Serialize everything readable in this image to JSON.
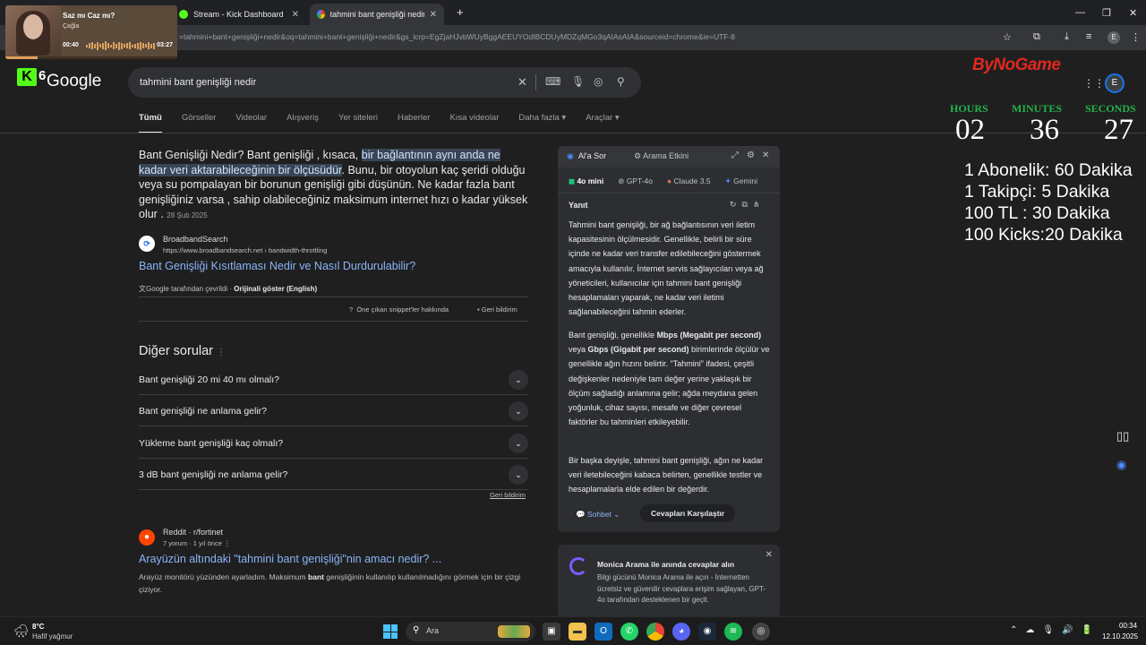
{
  "browser": {
    "tabs": [
      {
        "title": "Stream - Kick Dashboard"
      },
      {
        "title": "tahmini bant genişliği nedir - G"
      }
    ],
    "url": "=tahmini+bant+genişliği+nedir&oq=tahmini+bant+genişliği+nedir&gs_lcrp=EgZjaHJvbWUyBggAEEUYOdIBCDUyMDZqMGo3qAIAsAIA&sourceid=chrome&ie=UTF-8",
    "profile_initial": "E"
  },
  "media": {
    "song": "Saz mı Caz mı?",
    "artist": "Çağla",
    "elapsed": "00:40",
    "duration": "03:27",
    "progress": 0.19
  },
  "google": {
    "kick_badge": "K",
    "kick_number": "6",
    "logo": "Google",
    "query": "tahmini bant genişliği nedir",
    "account_initial": "E",
    "nav_tabs": [
      "Tümü",
      "Görseller",
      "Videolar",
      "Alışveriş",
      "Yer siteleri",
      "Haberler",
      "Kısa videolar",
      "Daha fazla ▾",
      "Araçlar ▾"
    ],
    "snippet": {
      "pre": "Bant Genişliği Nedir? Bant genişliği , kısaca, ",
      "highlight": "bir bağlantının aynı anda ne kadar veri aktarabileceğinin bir ölçüsüdür",
      "post": ". Bunu, bir otoyolun kaç şeridi olduğu veya su pompalayan bir borunun genişliği gibi düşünün. Ne kadar fazla bant genişliğiniz varsa , sahip olabileceğiniz maksimum internet hızı o kadar yüksek olur .",
      "date": "28 Şub 2025",
      "source_name": "BroadbandSearch",
      "source_url": "https://www.broadbandsearch.net › bandwidth-throttling",
      "source_title": "Bant Genişliği Kısıtlaması Nedir ve Nasıl Durdurulabilir?",
      "translated_prefix": "Google tarafından çevrildi · ",
      "translated_link": "Orijinali göster (English)",
      "about": "Öne çıkan snippet'ler hakkında",
      "feedback": "Geri bildirim"
    },
    "paa": {
      "title": "Diğer sorular",
      "questions": [
        "Bant genişliği 20 mi 40 mı olmalı?",
        "Bant genişliği ne anlama gelir?",
        "Yükleme bant genişliği kaç olmalı?",
        "3 dB bant genişliği ne anlama gelir?"
      ],
      "feedback": "Geri bildirim"
    },
    "reddit": {
      "name": "Reddit · r/fortinet",
      "meta": "7 yorum · 1 yıl önce",
      "title": "Arayüzün altındaki \"tahmini bant genişliği\"nin amacı nedir? ...",
      "desc_pre": "Arayüz monitörü yüzünden ayarladım. Maksimum ",
      "desc_bold": "bant",
      "desc_post": " genişliğinin kullanılıp kullanılmadığını görmek için bir çizgi çiziyor."
    }
  },
  "ai_panel": {
    "tab_ask": "Al'a Sor",
    "tab_effect": "Arama Etkini",
    "models": [
      "4o mini",
      "GPT-4o",
      "Claude 3.5",
      "Gemini"
    ],
    "answer_label": "Yanıt",
    "p1": "Tahmini bant genişliği, bir ağ bağlantısının veri iletim kapasitesinin ölçülmesidir. Genellikle, belirli bir süre içinde ne kadar veri transfer edilebileceğini göstermek amacıyla kullanılır. İnternet servis sağlayıcıları veya ağ yöneticileri, kullanıcılar için tahmini bant genişliği hesaplamaları yaparak, ne kadar veri iletimi sağlanabileceğini tahmin ederler.",
    "p2_a": "Bant genişliği, genellikle ",
    "p2_b": "Mbps (Megabit per second)",
    "p2_c": " veya ",
    "p2_d": "Gbps (Gigabit per second)",
    "p2_e": " birimlerinde ölçülür ve genellikle ağın hızını belirtir. \"Tahmini\" ifadesi, çeşitli değişkenler nedeniyle tam değer yerine yaklaşık bir ölçüm sağladığı anlamına gelir; ağda meydana gelen yoğunluk, cihaz sayısı, mesafe ve diğer çevresel faktörler bu tahminleri etkileyebilir.",
    "p3": "Bir başka deyişle, tahmini bant genişliği, ağın ne kadar veri iletebileceğini kabaca belirten, genellikle testler ve hesaplamalarla elde edilen bir değerdir.",
    "chat_label": "Sohbet",
    "compare_label": "Cevapları Karşılaştır"
  },
  "monica": {
    "title": "Monica Arama ile anında cevaplar alın",
    "desc": "Bilgi gücünü Monica Arama ile açın - İnternetten ücretsiz ve güvenilir cevaplara erişim sağlayan, GPT-4o tarafından desteklenen bir geçit."
  },
  "overlay": {
    "brand": "ByNoGame",
    "countdown": {
      "hours_label": "HOURS",
      "minutes_label": "MINUTES",
      "seconds_label": "SECONDS",
      "hours": "02",
      "minutes": "36",
      "seconds": "27"
    },
    "rates": [
      "1 Abonelik: 60 Dakika",
      "1 Takipçi: 5 Dakika",
      "100 TL : 30 Dakika",
      "100 Kicks:20 Dakika"
    ]
  },
  "taskbar": {
    "temperature": "8°C",
    "weather": "Hafif yağmur",
    "search_placeholder": "Ara",
    "time": "00:34",
    "date": "12.10.2025"
  },
  "colors": {
    "link": "#8ab4f8",
    "highlight_bg": "#394457",
    "countdown_label": "#24b24a",
    "brand": "#e0281e",
    "kick_green": "#53fc18"
  }
}
